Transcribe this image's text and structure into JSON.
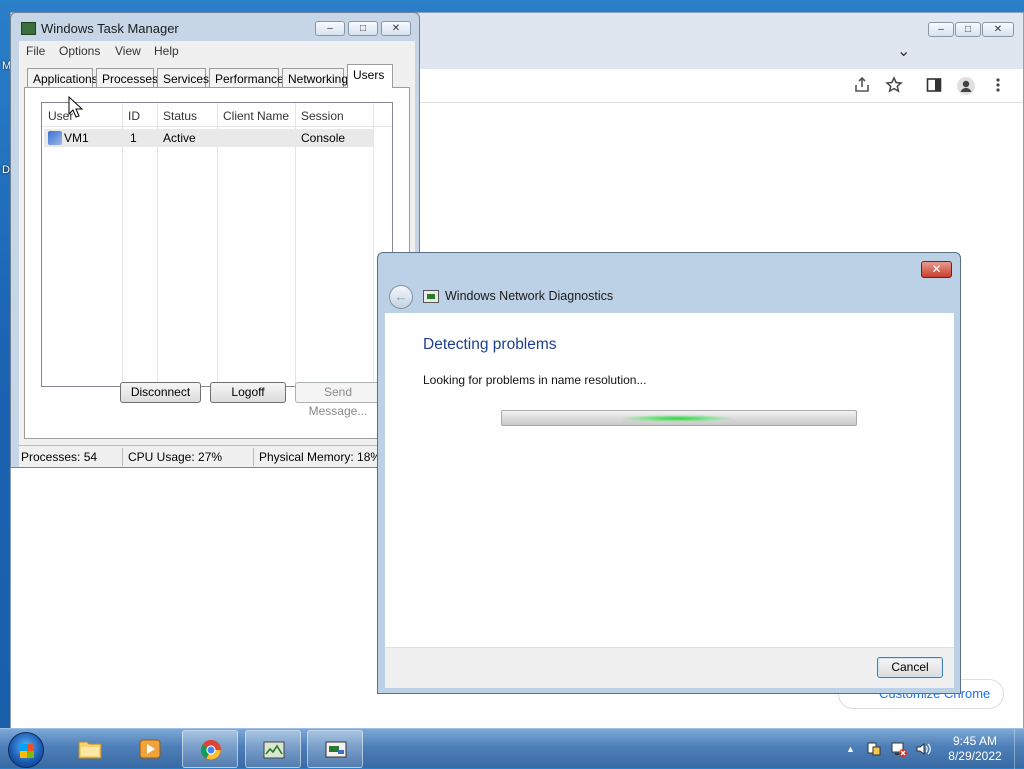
{
  "desktop": {
    "left_labels": [
      "M",
      "D"
    ]
  },
  "browser": {
    "caption_buttons": [
      "–",
      "□",
      "✕"
    ],
    "tab_overflow": "⌄",
    "toolbar_icons": [
      "share-icon",
      "star-icon",
      "sidebar-icon",
      "profile-icon",
      "menu-icon"
    ],
    "customize_label": "Customize Chrome"
  },
  "task_manager": {
    "title": "Windows Task Manager",
    "menu": [
      "File",
      "Options",
      "View",
      "Help"
    ],
    "tabs": [
      "Applications",
      "Processes",
      "Services",
      "Performance",
      "Networking",
      "Users"
    ],
    "active_tab": "Users",
    "columns": [
      "User",
      "ID",
      "Status",
      "Client Name",
      "Session"
    ],
    "rows": [
      {
        "user": "VM1",
        "id": "1",
        "status": "Active",
        "client_name": "",
        "session": "Console"
      }
    ],
    "buttons": {
      "disconnect": "Disconnect",
      "logoff": "Logoff",
      "send_message": "Send Message..."
    },
    "status": {
      "processes": "Processes: 54",
      "cpu": "CPU Usage: 27%",
      "memory": "Physical Memory: 18%"
    }
  },
  "diagnostics": {
    "title": "Windows Network Diagnostics",
    "heading": "Detecting problems",
    "message": "Looking for problems in name resolution...",
    "cancel": "Cancel",
    "close": "✕",
    "back": "←"
  },
  "taskbar": {
    "time": "9:45 AM",
    "date": "8/29/2022",
    "tray_arrow": "▲"
  }
}
